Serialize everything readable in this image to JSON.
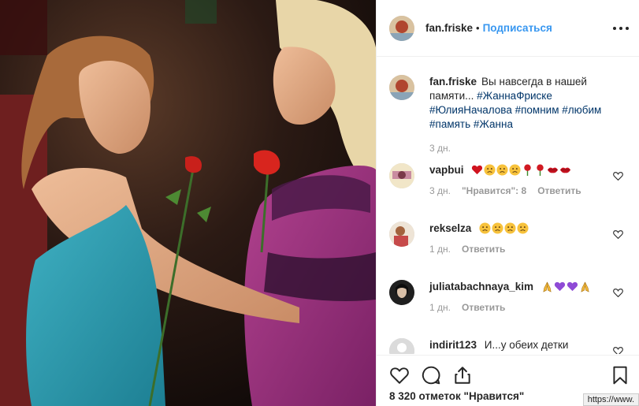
{
  "post": {
    "username": "fan.friske",
    "follow_label": "Подписаться",
    "separator": "•",
    "caption_text": "Вы навсегда в нашей памяти... ",
    "caption_tags": [
      "#ЖаннаФриске",
      "#ЮлияНачалова",
      "#помним",
      "#любим",
      "#память",
      "#Жанна"
    ],
    "caption_time": "3 дн.",
    "likes_text": "8 320 отметок \"Нравится\""
  },
  "comments": [
    {
      "username": "vapbui",
      "emoji": [
        "red-heart",
        "sad",
        "sad",
        "sad",
        "rose",
        "rose",
        "lips",
        "lips"
      ],
      "time": "3 дн.",
      "likes": "\"Нравится\": 8",
      "reply": "Ответить"
    },
    {
      "username": "rekselza",
      "emoji": [
        "sad",
        "sad",
        "sad",
        "sad"
      ],
      "time": "1 дн.",
      "reply": "Ответить"
    },
    {
      "username": "juliatabachnaya_kim",
      "emoji": [
        "pray",
        "purple-heart",
        "purple-heart",
        "pray"
      ],
      "time": "1 дн.",
      "reply": "Ответить"
    },
    {
      "username": "indirit123",
      "text": "И...у обеих детки"
    }
  ],
  "icons": [
    "more-icon",
    "like-icon",
    "comment-icon",
    "share-icon",
    "bookmark-icon",
    "heart-icon"
  ],
  "status_url": "https://www.",
  "colors": {
    "link": "#3897f0",
    "hashtag": "#003569",
    "muted": "#999999",
    "border": "#efefef"
  }
}
